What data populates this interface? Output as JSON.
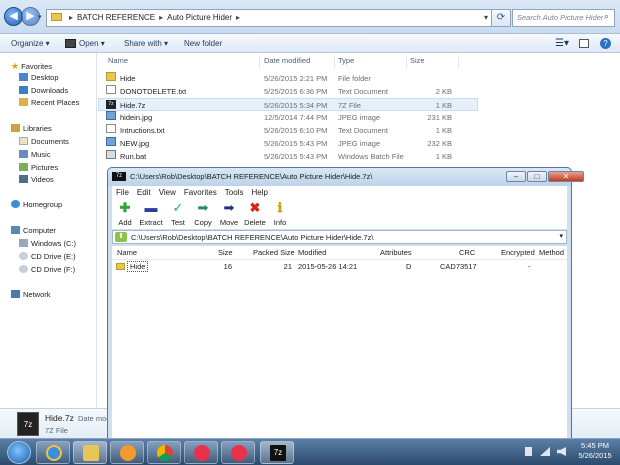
{
  "address": {
    "segments": [
      "BATCH REFERENCE",
      "Auto Picture Hider"
    ],
    "search_placeholder": "Search Auto Picture Hider"
  },
  "toolbar": {
    "organize": "Organize ▾",
    "open": "Open ▾",
    "share_with": "Share with ▾",
    "new_folder": "New folder"
  },
  "nav": {
    "favorites": "Favorites",
    "favorite_items": [
      "Desktop",
      "Downloads",
      "Recent Places"
    ],
    "libraries": "Libraries",
    "library_items": [
      "Documents",
      "Music",
      "Pictures",
      "Videos"
    ],
    "homegroup": "Homegroup",
    "computer": "Computer",
    "computer_items": [
      "Windows (C:)",
      "CD Drive (E:)",
      "CD Drive (F:)"
    ],
    "network": "Network"
  },
  "columns": {
    "name": "Name",
    "date": "Date modified",
    "type": "Type",
    "size": "Size"
  },
  "files": [
    {
      "name": "Hide",
      "date": "5/26/2015 2:21 PM",
      "type": "File folder",
      "size": "",
      "icon": "folder-icon"
    },
    {
      "name": "DONOTDELETE.txt",
      "date": "5/25/2015 6:36 PM",
      "type": "Text Document",
      "size": "2 KB",
      "icon": "text-file-icon"
    },
    {
      "name": "Hide.7z",
      "date": "5/26/2015 5:34 PM",
      "type": "7Z File",
      "size": "1 KB",
      "icon": "archive-icon"
    },
    {
      "name": "hidein.jpg",
      "date": "12/5/2014 7:44 PM",
      "type": "JPEG image",
      "size": "231 KB",
      "icon": "image-icon"
    },
    {
      "name": "Intructions.txt",
      "date": "5/26/2015 6:10 PM",
      "type": "Text Document",
      "size": "1 KB",
      "icon": "text-file-icon"
    },
    {
      "name": "NEW.jpg",
      "date": "5/26/2015 5:43 PM",
      "type": "JPEG image",
      "size": "232 KB",
      "icon": "image-icon"
    },
    {
      "name": "Run.bat",
      "date": "5/26/2015 5:43 PM",
      "type": "Windows Batch File",
      "size": "1 KB",
      "icon": "batch-file-icon"
    }
  ],
  "details": {
    "name": "Hide.7z",
    "date_label": "Date mod",
    "type": "7Z File"
  },
  "clock": {
    "time": "5:45 PM",
    "date": "5/26/2015"
  },
  "zip": {
    "title": "C:\\Users\\Rob\\Desktop\\BATCH REFERENCE\\Auto Picture Hider\\Hide.7z\\",
    "menu": [
      "File",
      "Edit",
      "View",
      "Favorites",
      "Tools",
      "Help"
    ],
    "tools": [
      "Add",
      "Extract",
      "Test",
      "Copy",
      "Move",
      "Delete",
      "Info"
    ],
    "path": "C:\\Users\\Rob\\Desktop\\BATCH REFERENCE\\Auto Picture Hider\\Hide.7z\\",
    "columns": {
      "name": "Name",
      "size": "Size",
      "packed": "Packed Size",
      "modified": "Modified",
      "attributes": "Attributes",
      "crc": "CRC",
      "encrypted": "Encrypted",
      "method": "Method"
    },
    "row": {
      "name": "Hide",
      "size": "16",
      "packed": "21",
      "modified": "2015-05-26 14:21",
      "attributes": "D",
      "crc": "CAD73517",
      "encrypted": "-"
    }
  },
  "taskbar_apps": [
    "Internet Explorer",
    "Windows Explorer",
    "Media Player",
    "Chrome",
    "iTunes",
    "iTunes",
    "7-Zip"
  ]
}
